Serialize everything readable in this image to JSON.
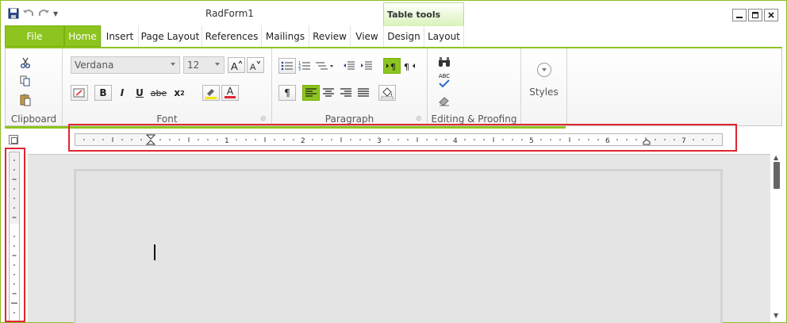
{
  "window": {
    "title": "RadForm1",
    "context_tab": "Table tools"
  },
  "tabs": {
    "file": "File",
    "items": [
      "Home",
      "Insert",
      "Page Layout",
      "References",
      "Mailings",
      "Review",
      "View",
      "Design",
      "Layout"
    ]
  },
  "font": {
    "family": "Verdana",
    "size": "12"
  },
  "groups": {
    "clipboard": "Clipboard",
    "font": "Font",
    "paragraph": "Paragraph",
    "editing": "Editing & Proofing",
    "styles": "Styles"
  },
  "buttons": {
    "bold": "B",
    "italic": "I",
    "underline": "U",
    "strike": "abe",
    "superscript": "x",
    "font_color": "A",
    "spell": "ABC"
  },
  "ruler": {
    "h_labels": [
      "1",
      "2",
      "3",
      "4",
      "5",
      "6",
      "7"
    ]
  },
  "colors": {
    "accent": "#8dc41f",
    "highlight": "#e0262f"
  }
}
